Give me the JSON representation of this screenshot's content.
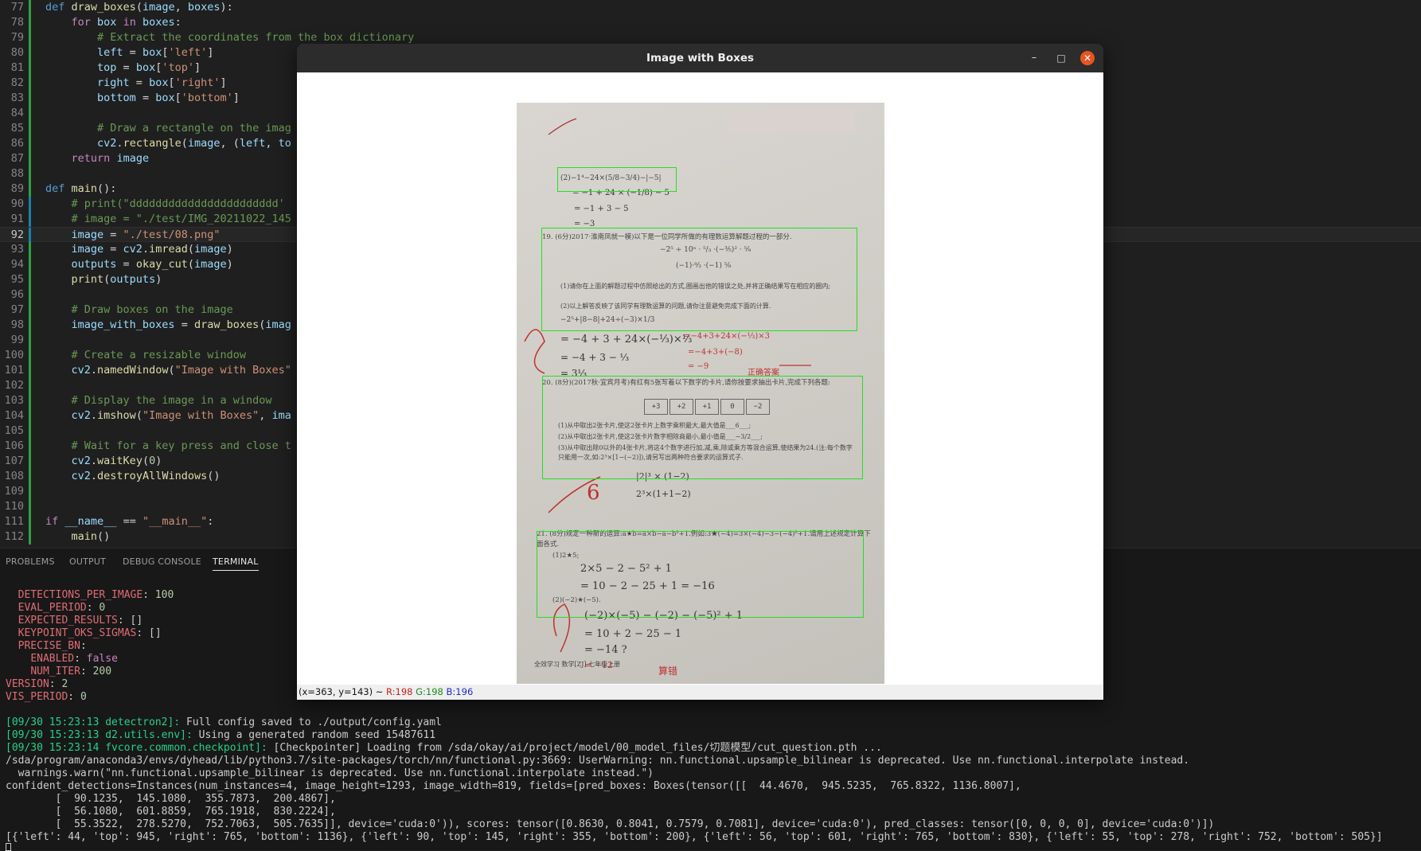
{
  "editor": {
    "lines": [
      {
        "n": "77",
        "html": "<span class='k'>def</span> <span class='fn'>draw_boxes</span>(<span class='v'>image</span>, <span class='v'>boxes</span>):"
      },
      {
        "n": "78",
        "html": "    <span class='kc'>for</span> <span class='v'>box</span> <span class='kc'>in</span> <span class='v'>boxes</span>:"
      },
      {
        "n": "79",
        "html": "        <span class='c'># Extract the coordinates from the box dictionary</span>"
      },
      {
        "n": "80",
        "html": "        <span class='v'>left</span> = <span class='v'>box</span>[<span class='s'>'left'</span>]"
      },
      {
        "n": "81",
        "html": "        <span class='v'>top</span> = <span class='v'>box</span>[<span class='s'>'top'</span>]"
      },
      {
        "n": "82",
        "html": "        <span class='v'>right</span> = <span class='v'>box</span>[<span class='s'>'right'</span>]"
      },
      {
        "n": "83",
        "html": "        <span class='v'>bottom</span> = <span class='v'>box</span>[<span class='s'>'bottom'</span>]"
      },
      {
        "n": "84",
        "html": ""
      },
      {
        "n": "85",
        "html": "        <span class='c'># Draw a rectangle on the imag</span>"
      },
      {
        "n": "86",
        "html": "        <span class='v'>cv2</span>.<span class='fn'>rectangle</span>(<span class='v'>image</span>, (<span class='v'>left</span>, <span class='v'>to</span>"
      },
      {
        "n": "87",
        "html": "    <span class='kc'>return</span> <span class='v'>image</span>"
      },
      {
        "n": "88",
        "html": ""
      },
      {
        "n": "89",
        "html": "<span class='k'>def</span> <span class='fn'>main</span>():"
      },
      {
        "n": "90",
        "html": "    <span class='c'># print(\"ddddddddddddddddddddddd'</span>"
      },
      {
        "n": "91",
        "html": "    <span class='c'># image = \"./test/IMG_20211022_145</span>"
      },
      {
        "n": "92",
        "html": "    <span class='v'>image</span> = <span class='s'>\"./test/08.png\"</span>"
      },
      {
        "n": "93",
        "html": "    <span class='v'>image</span> = <span class='v'>cv2</span>.<span class='fn'>imread</span>(<span class='v'>image</span>)"
      },
      {
        "n": "94",
        "html": "    <span class='v'>outputs</span> = <span class='fn'>okay_cut</span>(<span class='v'>image</span>)"
      },
      {
        "n": "95",
        "html": "    <span class='fn'>print</span>(<span class='v'>outputs</span>)"
      },
      {
        "n": "96",
        "html": ""
      },
      {
        "n": "97",
        "html": "    <span class='c'># Draw boxes on the image</span>"
      },
      {
        "n": "98",
        "html": "    <span class='v'>image_with_boxes</span> = <span class='fn'>draw_boxes</span>(<span class='v'>imag</span>"
      },
      {
        "n": "99",
        "html": ""
      },
      {
        "n": "100",
        "html": "    <span class='c'># Create a resizable window</span>"
      },
      {
        "n": "101",
        "html": "    <span class='v'>cv2</span>.<span class='fn'>namedWindow</span>(<span class='s'>\"Image with Boxes\"</span>"
      },
      {
        "n": "102",
        "html": ""
      },
      {
        "n": "103",
        "html": "    <span class='c'># Display the image in a window</span>"
      },
      {
        "n": "104",
        "html": "    <span class='v'>cv2</span>.<span class='fn'>imshow</span>(<span class='s'>\"Image with Boxes\"</span>, <span class='v'>ima</span>"
      },
      {
        "n": "105",
        "html": ""
      },
      {
        "n": "106",
        "html": "    <span class='c'># Wait for a key press and close t</span>"
      },
      {
        "n": "107",
        "html": "    <span class='v'>cv2</span>.<span class='fn'>waitKey</span>(<span class='n'>0</span>)"
      },
      {
        "n": "108",
        "html": "    <span class='v'>cv2</span>.<span class='fn'>destroyAllWindows</span>()"
      },
      {
        "n": "109",
        "html": ""
      },
      {
        "n": "110",
        "html": ""
      },
      {
        "n": "111",
        "html": "<span class='kc'>if</span> <span class='v'>__name__</span> == <span class='s'>\"__main__\"</span>:"
      },
      {
        "n": "112",
        "html": "    <span class='fn'>main</span>()"
      }
    ]
  },
  "panel": {
    "tabs": [
      "PROBLEMS",
      "OUTPUT",
      "DEBUG CONSOLE",
      "TERMINAL"
    ],
    "active_tab": "TERMINAL"
  },
  "terminal": {
    "lines": [
      "  <span class='key'>DETECTIONS_PER_IMAGE</span>: <span class='num'>100</span>",
      "  <span class='key'>EVAL_PERIOD</span>: <span class='num'>0</span>",
      "  <span class='key'>EXPECTED_RESULTS</span>: []",
      "  <span class='key'>KEYPOINT_OKS_SIGMAS</span>: []",
      "  <span class='key'>PRECISE_BN</span>:",
      "    <span class='key'>ENABLED</span>: <span class='fal'>false</span>",
      "    <span class='key'>NUM_ITER</span>: <span class='num'>200</span>",
      "<span class='key'>VERSION</span>: <span class='num'>2</span>",
      "<span class='key'>VIS_PERIOD</span>: <span class='num'>0</span>",
      "",
      "<span class='grn'>[09/30 15:23:13 detectron2]:</span> Full config saved to ./output/config.yaml",
      "<span class='grn'>[09/30 15:23:13 d2.utils.env]:</span> Using a generated random seed 15487611",
      "<span class='grn'>[09/30 15:23:14 fvcore.common.checkpoint]:</span> [Checkpointer] Loading from /sda/okay/ai/project/model/00_model_files/切题模型/cut_question.pth ...",
      "/sda/program/anaconda3/envs/dyhead/lib/python3.7/site-packages/torch/nn/functional.py:3669: UserWarning: nn.functional.upsample_bilinear is deprecated. Use nn.functional.interpolate instead.",
      "  warnings.warn(\"nn.functional.upsample_bilinear is deprecated. Use nn.functional.interpolate instead.\")",
      "confident_detections=Instances(num_instances=4, image_height=1293, image_width=819, fields=[pred_boxes: Boxes(tensor([[  44.4670,  945.5235,  765.8322, 1136.8007],",
      "        [  90.1235,  145.1080,  355.7873,  200.4867],",
      "        [  56.1080,  601.8859,  765.1918,  830.2224],",
      "        [  55.3522,  278.5270,  752.7063,  505.7635]], device='cuda:0')), scores: tensor([0.8630, 0.8041, 0.7579, 0.7081], device='cuda:0'), pred_classes: tensor([0, 0, 0, 0], device='cuda:0')])",
      "[{'left': 44, 'top': 945, 'right': 765, 'bottom': 1136}, {'left': 90, 'top': 145, 'right': 355, 'bottom': 200}, {'left': 56, 'top': 601, 'right': 765, 'bottom': 830}, {'left': 55, 'top': 278, 'right': 752, 'bottom': 505}]"
    ]
  },
  "window": {
    "title": "Image with Boxes",
    "minimize": "–",
    "maximize": "□",
    "close": "✕",
    "status": {
      "coords": "(x=363, y=143) ~",
      "r": "R:198",
      "g": "G:198",
      "b": "B:196"
    },
    "colors": {
      "box": "#22e022",
      "accent": "#e95420"
    }
  },
  "document": {
    "q18": "(2)−1⁴−24×(5/8−3/4)−|−5|",
    "q19_head": "19. (6分)2017·淮南凤就一模)以下是一位同学所做的有理数运算解题过程的一部分.",
    "q19_a": "(1)请你在上面的解题过程中仿照给出的方式,圈画出他的错误之处,并将正确结果写在相应的圈内;",
    "q19_b": "(2)以上解答反映了该同学有理数运算的问题,请你注意避免完成下面的计算.",
    "q19_expr": "−2⁵+|8−8|+24÷(−3)×1/3",
    "q20_head": "20. (8分)(2017秋·宜宾月考)有红有5张写着以下数字的卡片,请你按要求抽出卡片,完成下列各题:",
    "q20_cards": [
      "+3",
      "+2",
      "+1",
      "0",
      "−2"
    ],
    "q20_a": "(1)从中取出2张卡片,使这2张卡片上数字乘积最大,最大值是___6___;",
    "q20_b": "(2)从中取出2张卡片,使这2张卡片数字相除商最小,最小值是___−3/2___;",
    "q20_c": "(3)从中取出除0以外的4张卡片,将这4个数字进行加,减,乘,除或乘方等混合运算,使结果为24.(注:每个数字只能用一次,如:2³×[1−(−2)]),请另写出两种符合要求的运算式子.",
    "q21_head": "21. (8分)规定一种新的运算:a★b=a×b−a−b²+1.例如:3★(−4)=3×(−4)−3−(−4)²+1.请用上述规定计算下面各式.",
    "q21_a": "(1)2★5;",
    "q21_b": "(2)(−2)★(−5).",
    "footer": "全效学习   数学[ZJ]  七年级上册"
  }
}
